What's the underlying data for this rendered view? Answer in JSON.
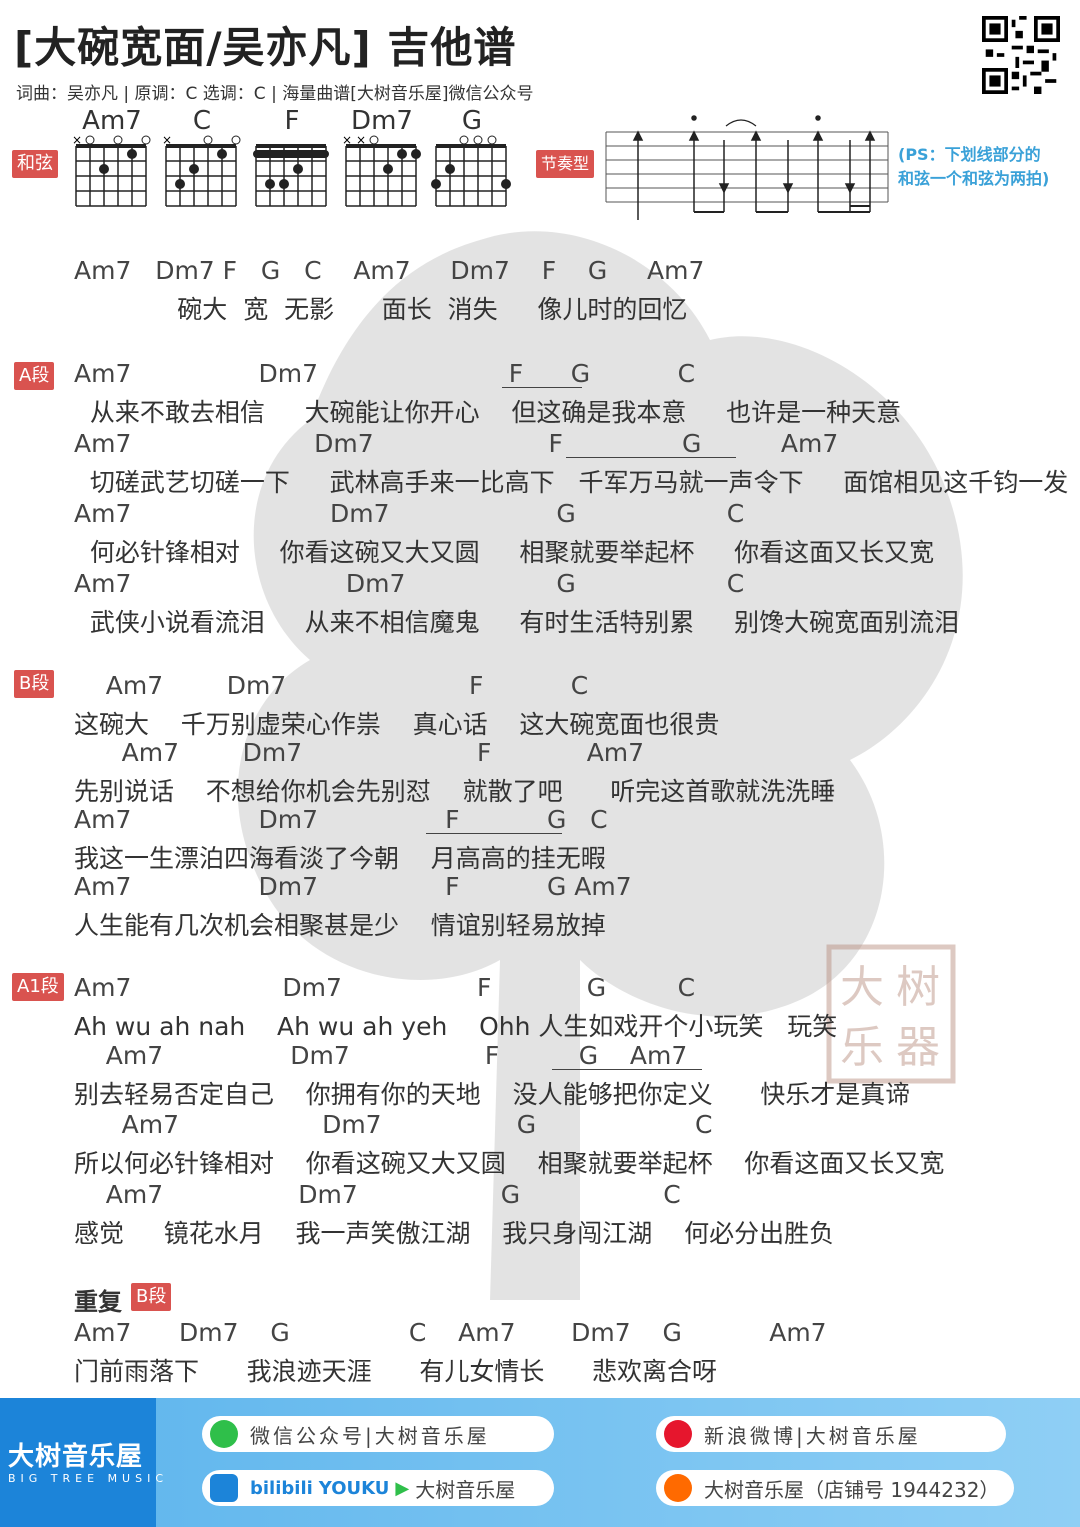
{
  "header": {
    "title": "[大碗宽面/吴亦凡] 吉他谱",
    "meta": "词曲：吴亦凡 | 原调：C 选调：C | 海量曲谱[大树音乐屋]微信公众号"
  },
  "chords_label": "和弦",
  "rhythm_label": "节奏型",
  "ps_note": [
    "(PS：下划线部分的",
    "和弦一个和弦为两拍)"
  ],
  "chord_names": [
    "Am7",
    "C",
    "F",
    "Dm7",
    "G"
  ],
  "sections": {
    "intro": {
      "lines": [
        {
          "chords": "Am7   Dm7 F   G   C    Am7     Dm7    F    G     Am7",
          "lyric": "             碗大  宽  无影      面长  消失     像儿时的回忆"
        }
      ]
    },
    "a": {
      "label": "A段",
      "lines": [
        {
          "chords": "Am7                Dm7                        F      G           C",
          "lyric": "  从来不敢去相信     大碗能让你开心    但这确是我本意     也许是一种天意"
        },
        {
          "chords": "Am7                       Dm7                      F               G          Am7",
          "lyric": "  切磋武艺切磋一下     武林高手来一比高下   千军万马就一声令下     面馆相见这千钧一发"
        },
        {
          "chords": "Am7                         Dm7                     G                   C",
          "lyric": "  何必针锋相对     你看这碗又大又圆     相聚就要举起杯     你看这面又长又宽"
        },
        {
          "chords": "Am7                           Dm7                   G                   C",
          "lyric": "  武侠小说看流泪     从来不相信魔鬼     有时生活特别累     别馋大碗宽面别流泪"
        }
      ]
    },
    "b": {
      "label": "B段",
      "lines": [
        {
          "chords": "    Am7        Dm7                       F           C",
          "lyric": "这碗大    千万别虚荣心作祟    真心话    这大碗宽面也很贵"
        },
        {
          "chords": "      Am7        Dm7                      F            Am7",
          "lyric": "先别说话    不想给你机会先别怼    就散了吧      听完这首歌就洗洗睡"
        },
        {
          "chords": "Am7                Dm7                F           G   C",
          "lyric": "我这一生漂泊四海看淡了今朝    月高高的挂无暇"
        },
        {
          "chords": "Am7                Dm7                F           G Am7",
          "lyric": "人生能有几次机会相聚甚是少    情谊别轻易放掉"
        }
      ]
    },
    "a1": {
      "label": "A1段",
      "lines": [
        {
          "chords": "Am7                   Dm7                 F            G         C",
          "lyric": "Ah wu ah nah    Ah wu ah yeh    Ohh 人生如戏开个小玩笑   玩笑"
        },
        {
          "chords": "    Am7                Dm7                 F          G    Am7",
          "lyric": "别去轻易否定自己    你拥有你的天地    没人能够把你定义      快乐才是真谛"
        },
        {
          "chords": "      Am7                  Dm7                 G                    C",
          "lyric": "所以何必针锋相对    你看这碗又大又圆    相聚就要举起杯    你看这面又长又宽"
        },
        {
          "chords": "    Am7                 Dm7                  G                  C",
          "lyric": "感觉     镜花水月    我一声笑傲江湖    我只身闯江湖    何必分出胜负"
        }
      ]
    },
    "repeat": {
      "title": "重复",
      "label": "B段",
      "lines": [
        {
          "chords": "Am7      Dm7    G               C    Am7       Dm7    G           Am7",
          "lyric": "门前雨落下      我浪迹天涯      有儿女情长      悲欢离合呀"
        }
      ]
    }
  },
  "watermark_seal": [
    "大",
    "树",
    "乐",
    "器"
  ],
  "footer": {
    "brand_cn": "大树音乐屋",
    "brand_en": "BIG TREE MUSIC",
    "wechat": "微信公众号|大树音乐屋",
    "weibo": "新浪微博|大树音乐屋",
    "video": "bilibili YOUKU ▶ 大树音乐屋",
    "video_bili": "bilibili",
    "video_youku": "YOUKU",
    "video_name": "大树音乐屋",
    "taobao": "大树音乐屋（店铺号 1944232）"
  },
  "colors": {
    "label_red": "#d9534f",
    "ps_blue": "#3aa1d8",
    "footer_blue": "#1c84d9"
  }
}
